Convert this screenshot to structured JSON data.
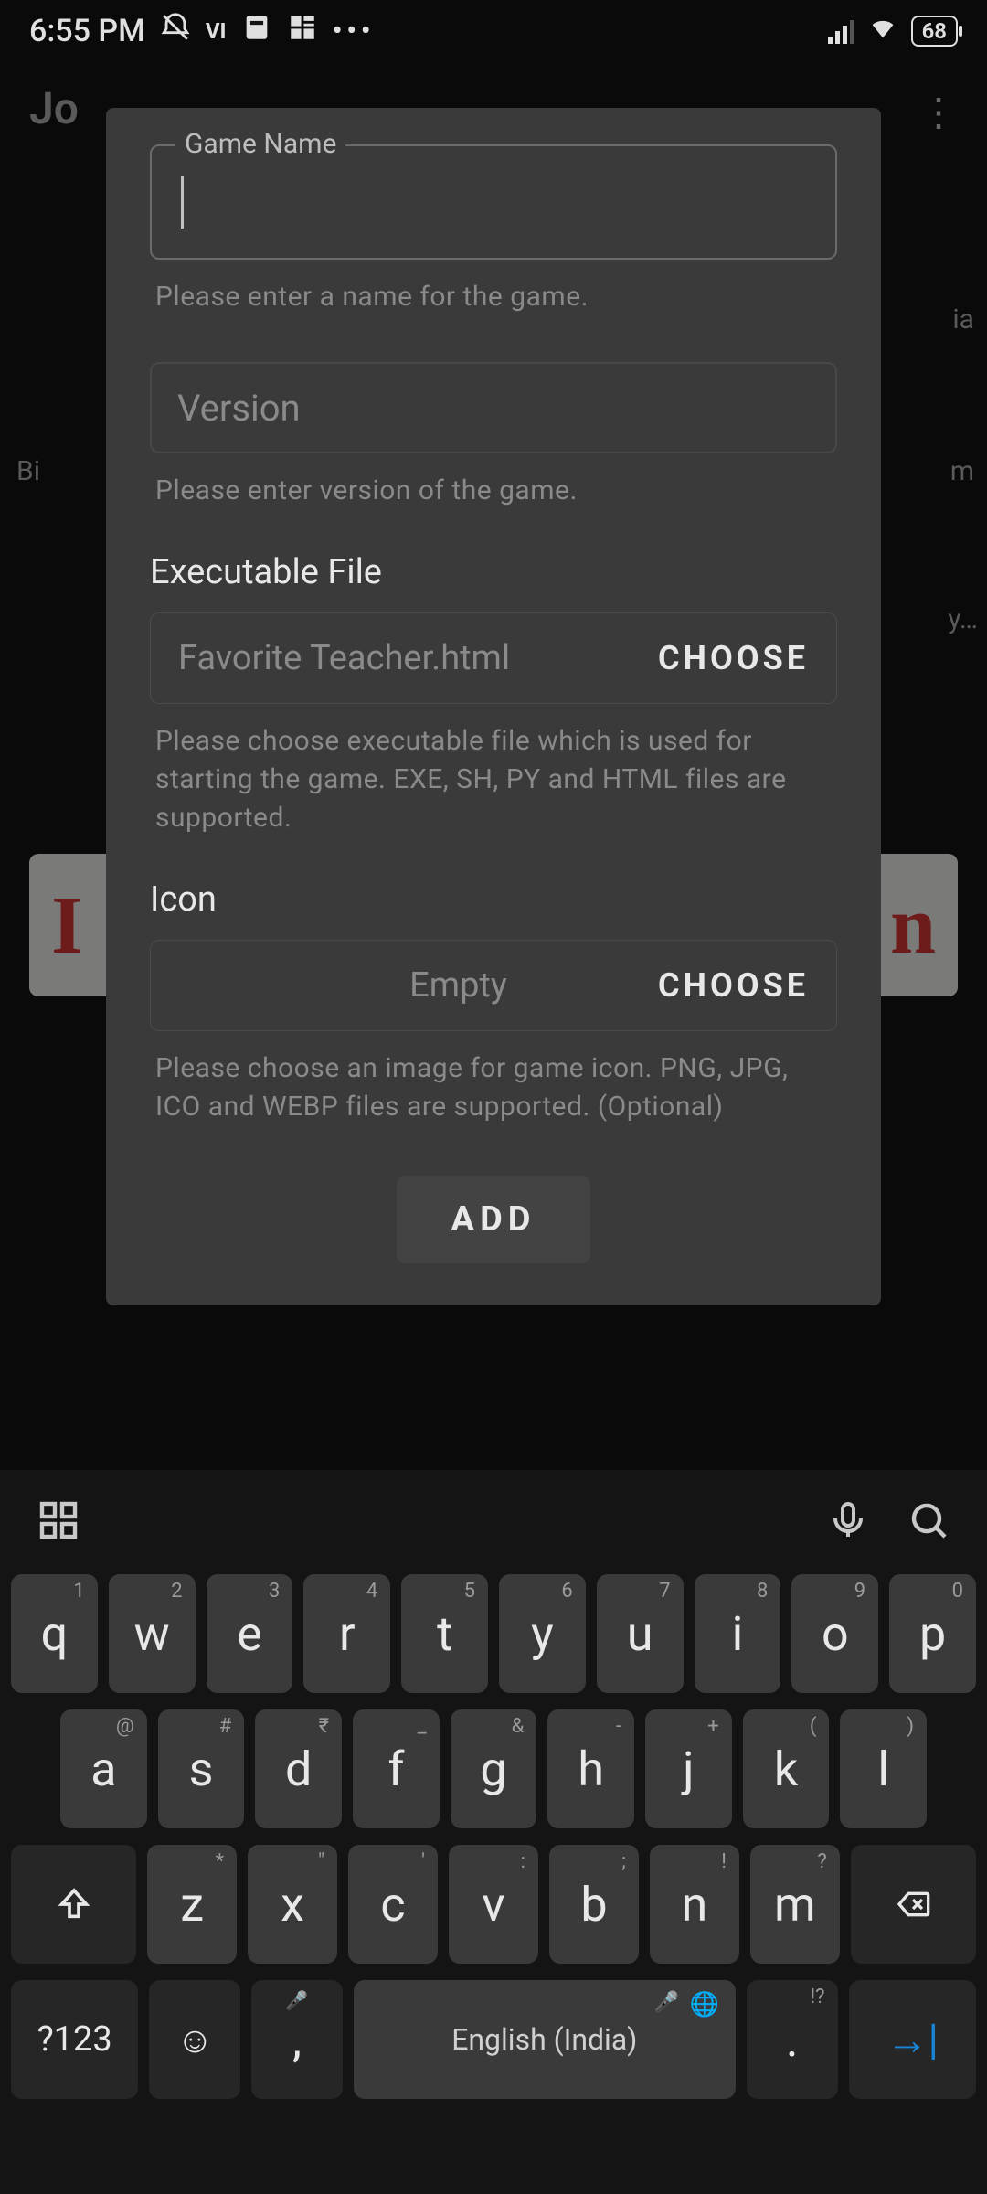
{
  "status": {
    "time": "6:55 PM",
    "carrier_label": "VI",
    "battery": "68"
  },
  "background": {
    "title_fragment": "Jo",
    "side_text_1": "ia",
    "side_text_2": "Bi",
    "side_text_3": "m",
    "side_text_4": "y…",
    "banner_left": "I",
    "banner_right": "n"
  },
  "dialog": {
    "game_name": {
      "label": "Game Name",
      "value": "",
      "helper": "Please enter a name for the game."
    },
    "version": {
      "placeholder": "Version",
      "value": "",
      "helper": "Please enter version of the game."
    },
    "executable": {
      "label": "Executable File",
      "value": "Favorite Teacher.html",
      "choose": "CHOOSE",
      "helper": "Please choose executable file which is used for starting the game. EXE, SH, PY and HTML files are supported."
    },
    "icon": {
      "label": "Icon",
      "value": "Empty",
      "choose": "CHOOSE",
      "helper": "Please choose an image for game icon. PNG, JPG, ICO and WEBP files are supported. (Optional)"
    },
    "add_button": "ADD"
  },
  "keyboard": {
    "row1": [
      {
        "main": "q",
        "sec": "1"
      },
      {
        "main": "w",
        "sec": "2"
      },
      {
        "main": "e",
        "sec": "3"
      },
      {
        "main": "r",
        "sec": "4"
      },
      {
        "main": "t",
        "sec": "5"
      },
      {
        "main": "y",
        "sec": "6"
      },
      {
        "main": "u",
        "sec": "7"
      },
      {
        "main": "i",
        "sec": "8"
      },
      {
        "main": "o",
        "sec": "9"
      },
      {
        "main": "p",
        "sec": "0"
      }
    ],
    "row2": [
      {
        "main": "a",
        "sec": "@"
      },
      {
        "main": "s",
        "sec": "#"
      },
      {
        "main": "d",
        "sec": "₹"
      },
      {
        "main": "f",
        "sec": "_"
      },
      {
        "main": "g",
        "sec": "&"
      },
      {
        "main": "h",
        "sec": "-"
      },
      {
        "main": "j",
        "sec": "+"
      },
      {
        "main": "k",
        "sec": "("
      },
      {
        "main": "l",
        "sec": ")"
      }
    ],
    "row3": [
      {
        "main": "z",
        "sec": "*"
      },
      {
        "main": "x",
        "sec": "\""
      },
      {
        "main": "c",
        "sec": "'"
      },
      {
        "main": "v",
        "sec": ":"
      },
      {
        "main": "b",
        "sec": ";"
      },
      {
        "main": "n",
        "sec": "!"
      },
      {
        "main": "m",
        "sec": "?"
      }
    ],
    "symbols_key": "?123",
    "space": "English (India)",
    "period": ".",
    "period_sec": "!?",
    "comma": ","
  }
}
